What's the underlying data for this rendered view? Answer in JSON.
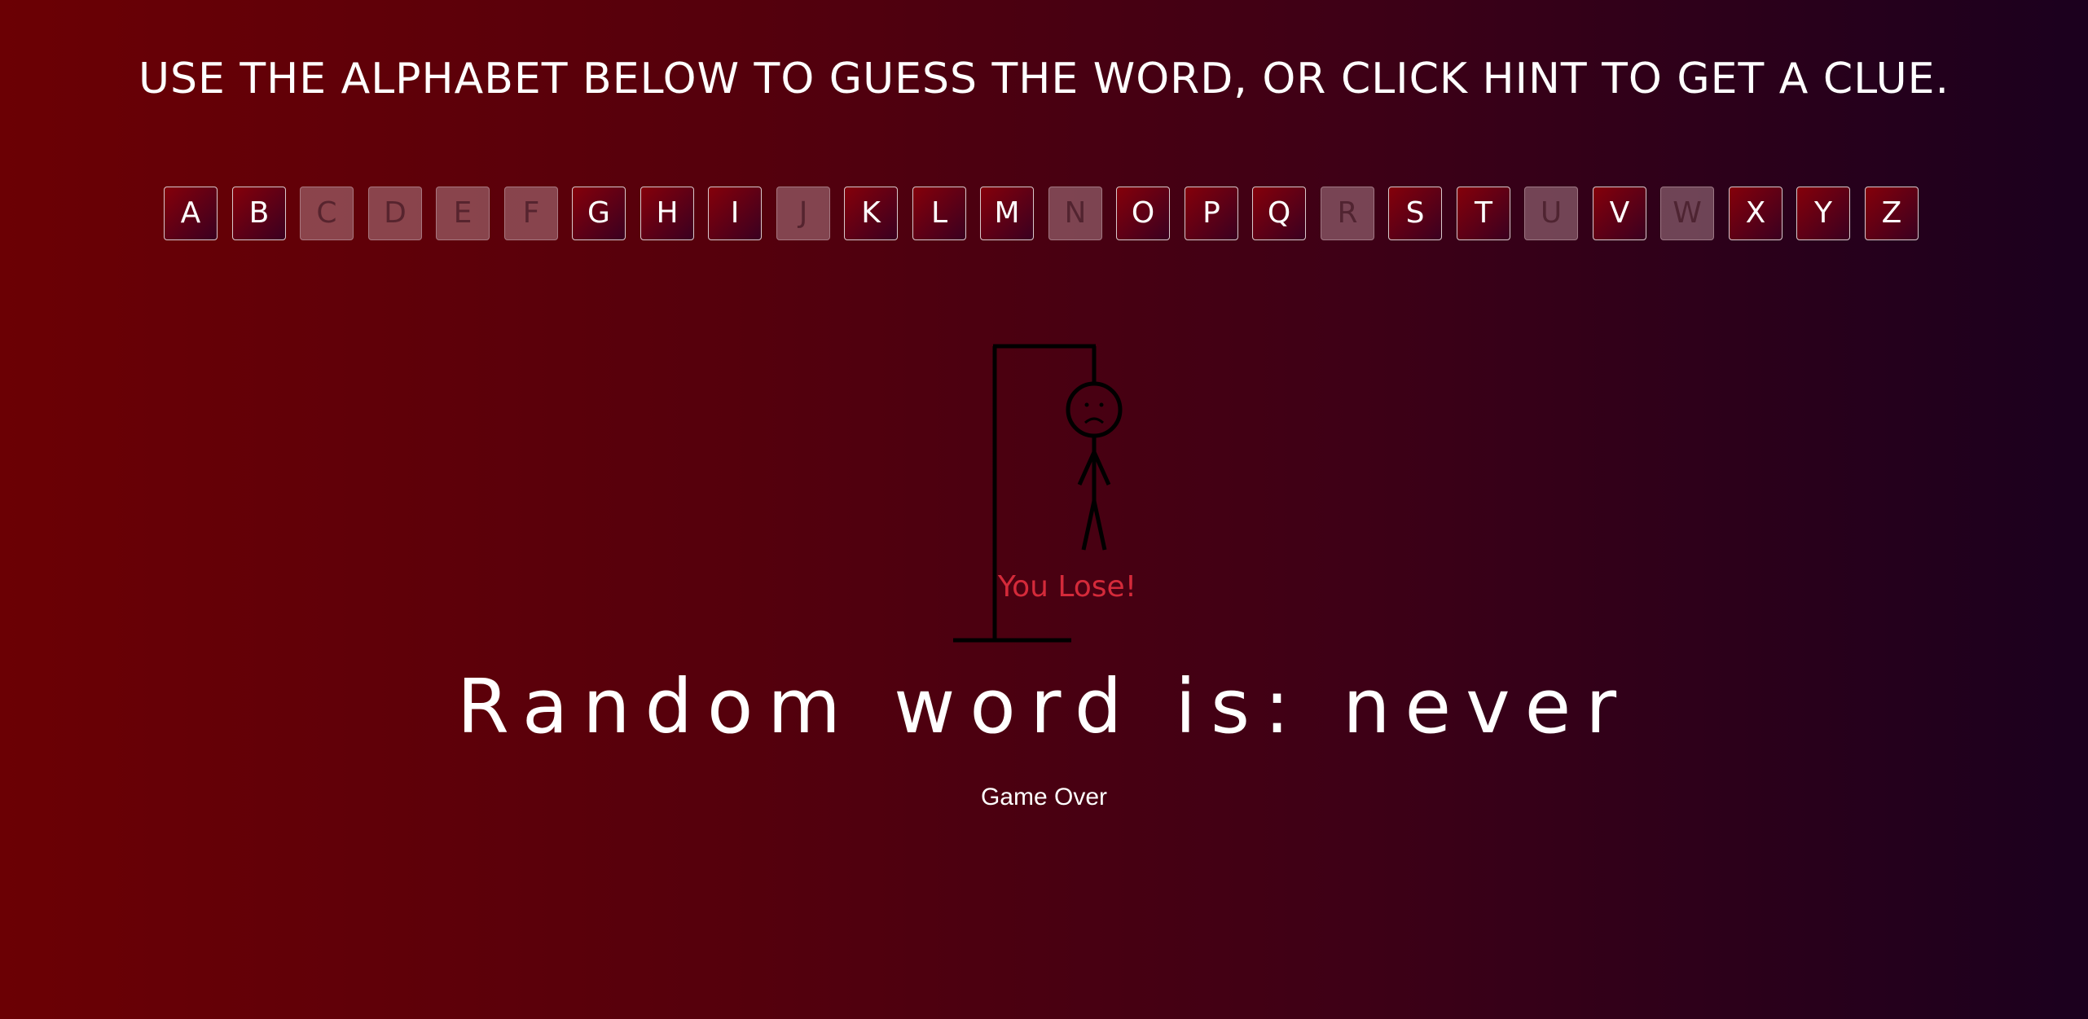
{
  "instructions": "USE THE ALPHABET BELOW TO GUESS THE WORD, OR CLICK HINT TO GET A CLUE.",
  "alphabet": [
    {
      "letter": "A",
      "used": false
    },
    {
      "letter": "B",
      "used": false
    },
    {
      "letter": "C",
      "used": true
    },
    {
      "letter": "D",
      "used": true
    },
    {
      "letter": "E",
      "used": true
    },
    {
      "letter": "F",
      "used": true
    },
    {
      "letter": "G",
      "used": false
    },
    {
      "letter": "H",
      "used": false
    },
    {
      "letter": "I",
      "used": false
    },
    {
      "letter": "J",
      "used": true
    },
    {
      "letter": "K",
      "used": false
    },
    {
      "letter": "L",
      "used": false
    },
    {
      "letter": "M",
      "used": false
    },
    {
      "letter": "N",
      "used": true
    },
    {
      "letter": "O",
      "used": false
    },
    {
      "letter": "P",
      "used": false
    },
    {
      "letter": "Q",
      "used": false
    },
    {
      "letter": "R",
      "used": true
    },
    {
      "letter": "S",
      "used": false
    },
    {
      "letter": "T",
      "used": false
    },
    {
      "letter": "U",
      "used": true
    },
    {
      "letter": "V",
      "used": false
    },
    {
      "letter": "W",
      "used": true
    },
    {
      "letter": "X",
      "used": false
    },
    {
      "letter": "Y",
      "used": false
    },
    {
      "letter": "Z",
      "used": false
    }
  ],
  "result_message": "You Lose!",
  "word_display": "Random word is: never",
  "status": "Game Over",
  "colors": {
    "background_start": "#6b0004",
    "background_end": "#1b001e",
    "lose_text": "#d42a3a",
    "gallows": "#000000"
  }
}
